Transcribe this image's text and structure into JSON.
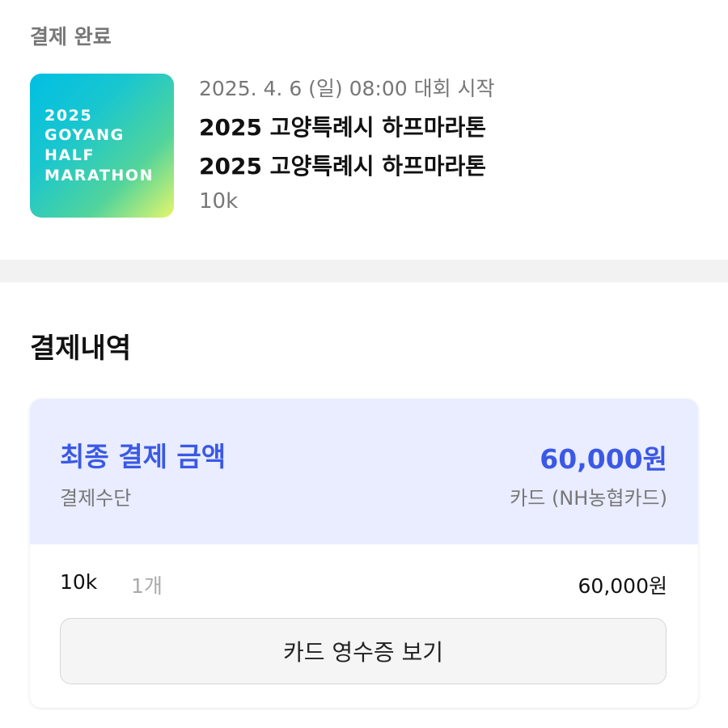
{
  "status": {
    "label": "결제 완료"
  },
  "event": {
    "thumbnail_lines": [
      "2025",
      "GOYANG",
      "HALF",
      "MARATHON"
    ],
    "date": "2025. 4. 6 (일) 08:00 대회 시작",
    "title_primary": "2025 고양특례시 하프마라톤",
    "title_secondary": "2025 고양특례시 하프마라톤",
    "course": "10k"
  },
  "payment": {
    "section_title": "결제내역",
    "final_label": "최종 결제 금액",
    "final_amount": "60,000원",
    "method_label": "결제수단",
    "method_value": "카드 (NH농협카드)",
    "items": [
      {
        "name": "10k",
        "qty": "1개",
        "price": "60,000원"
      }
    ],
    "receipt_button_label": "카드 영수증 보기"
  },
  "colors": {
    "accent": "#3b59e6",
    "summary_bg": "#e9edff",
    "muted_text": "#777777",
    "divider_band": "#f2f2f2"
  }
}
